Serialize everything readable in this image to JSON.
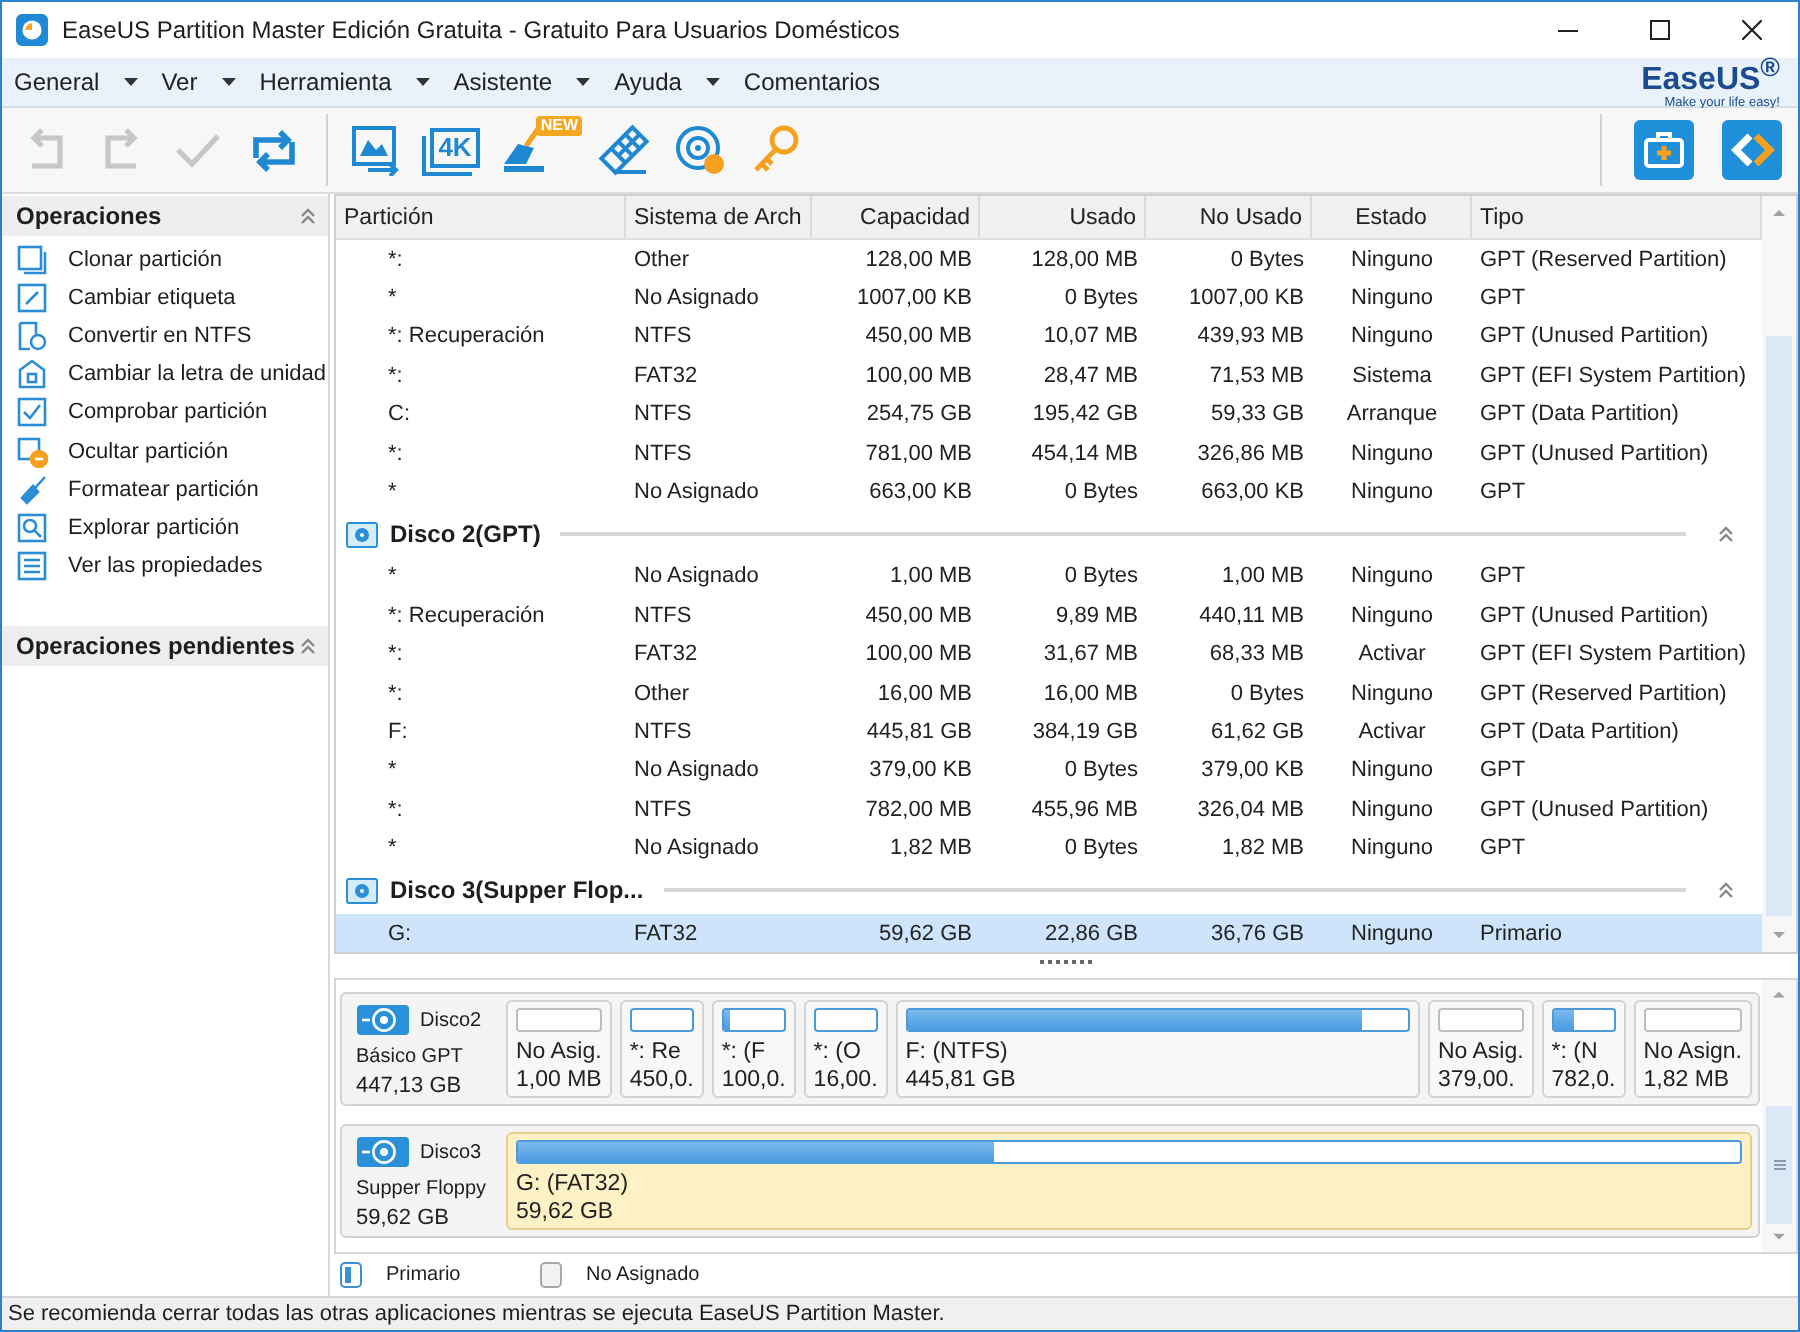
{
  "window": {
    "title": "EaseUS Partition Master Edición Gratuita - Gratuito Para Usuarios Domésticos"
  },
  "menu": [
    {
      "label": "General",
      "dropdown": true
    },
    {
      "label": "Ver",
      "dropdown": true
    },
    {
      "label": "Herramienta",
      "dropdown": true
    },
    {
      "label": "Asistente",
      "dropdown": true
    },
    {
      "label": "Ayuda",
      "dropdown": true
    },
    {
      "label": "Comentarios",
      "dropdown": false
    }
  ],
  "logo": {
    "name": "EaseUS$^{®}$",
    "tagline": "Make your life easy!"
  },
  "toolbar": {
    "buttons": [
      {
        "disabled": true
      },
      {
        "disabled": true
      },
      {
        "disabled": true
      },
      {
        "disabled": false
      },
      {
        "disabled": false
      },
      {
        "disabled": false,
        "text": "4K"
      },
      {
        "disabled": false,
        "badge": "NEW"
      },
      {
        "disabled": false
      },
      {
        "disabled": false
      },
      {
        "disabled": false
      }
    ]
  },
  "sidebar": {
    "sections": [
      {
        "title": "Operaciones",
        "expanded": true,
        "items": [
          "Clonar partición",
          "Cambiar etiqueta",
          "Convertir en NTFS",
          "Cambiar la letra de unidad",
          "Comprobar partición",
          "Ocultar partición",
          "Formatear partición",
          "Explorar partición",
          "Ver las propiedades"
        ]
      },
      {
        "title": "Operaciones pendientes",
        "expanded": true
      }
    ]
  },
  "table": {
    "columns": [
      "Partición",
      "Sistema de Arch",
      "Capacidad",
      "Usado",
      "No Usado",
      "Estado",
      "Tipo"
    ],
    "rows": [
      {
        "kind": "partition",
        "selected": false,
        "cells": [
          "*:",
          "Other",
          "128,00 MB",
          "128,00 MB",
          "0 Bytes",
          "Ninguno",
          "GPT (Reserved Partition)"
        ]
      },
      {
        "kind": "partition",
        "selected": false,
        "cells": [
          "*",
          "No Asignado",
          "1007,00 KB",
          "0 Bytes",
          "1007,00 KB",
          "Ninguno",
          "GPT"
        ]
      },
      {
        "kind": "partition",
        "selected": false,
        "cells": [
          "*: Recuperación",
          "NTFS",
          "450,00 MB",
          "10,07 MB",
          "439,93 MB",
          "Ninguno",
          "GPT (Unused Partition)"
        ]
      },
      {
        "kind": "partition",
        "selected": false,
        "cells": [
          "*:",
          "FAT32",
          "100,00 MB",
          "28,47 MB",
          "71,53 MB",
          "Sistema",
          "GPT (EFI System Partition)"
        ]
      },
      {
        "kind": "partition",
        "selected": false,
        "cells": [
          "C:",
          "NTFS",
          "254,75 GB",
          "195,42 GB",
          "59,33 GB",
          "Arranque",
          "GPT (Data Partition)"
        ]
      },
      {
        "kind": "partition",
        "selected": false,
        "cells": [
          "*:",
          "NTFS",
          "781,00 MB",
          "454,14 MB",
          "326,86 MB",
          "Ninguno",
          "GPT (Unused Partition)"
        ]
      },
      {
        "kind": "partition",
        "selected": false,
        "cells": [
          "*",
          "No Asignado",
          "663,00 KB",
          "0 Bytes",
          "663,00 KB",
          "Ninguno",
          "GPT"
        ]
      },
      {
        "kind": "disk",
        "label": "Disco 2(GPT)",
        "expanded": true
      },
      {
        "kind": "partition",
        "selected": false,
        "cells": [
          "*",
          "No Asignado",
          "1,00 MB",
          "0 Bytes",
          "1,00 MB",
          "Ninguno",
          "GPT"
        ]
      },
      {
        "kind": "partition",
        "selected": false,
        "cells": [
          "*: Recuperación",
          "NTFS",
          "450,00 MB",
          "9,89 MB",
          "440,11 MB",
          "Ninguno",
          "GPT (Unused Partition)"
        ]
      },
      {
        "kind": "partition",
        "selected": false,
        "cells": [
          "*:",
          "FAT32",
          "100,00 MB",
          "31,67 MB",
          "68,33 MB",
          "Activar",
          "GPT (EFI System Partition)"
        ]
      },
      {
        "kind": "partition",
        "selected": false,
        "cells": [
          "*:",
          "Other",
          "16,00 MB",
          "16,00 MB",
          "0 Bytes",
          "Ninguno",
          "GPT (Reserved Partition)"
        ]
      },
      {
        "kind": "partition",
        "selected": false,
        "cells": [
          "F:",
          "NTFS",
          "445,81 GB",
          "384,19 GB",
          "61,62 GB",
          "Activar",
          "GPT (Data Partition)"
        ]
      },
      {
        "kind": "partition",
        "selected": false,
        "cells": [
          "*",
          "No Asignado",
          "379,00 KB",
          "0 Bytes",
          "379,00 KB",
          "Ninguno",
          "GPT"
        ]
      },
      {
        "kind": "partition",
        "selected": false,
        "cells": [
          "*:",
          "NTFS",
          "782,00 MB",
          "455,96 MB",
          "326,04 MB",
          "Ninguno",
          "GPT (Unused Partition)"
        ]
      },
      {
        "kind": "partition",
        "selected": false,
        "cells": [
          "*",
          "No Asignado",
          "1,82 MB",
          "0 Bytes",
          "1,82 MB",
          "Ninguno",
          "GPT"
        ]
      },
      {
        "kind": "disk",
        "label": "Disco 3(Supper Flop...",
        "expanded": true
      },
      {
        "kind": "partition",
        "selected": true,
        "cells": [
          "G:",
          "FAT32",
          "59,62 GB",
          "22,86 GB",
          "36,76 GB",
          "Ninguno",
          "Primario"
        ]
      }
    ]
  },
  "disk_map": {
    "disks": [
      {
        "name": "Disco2",
        "type": "Básico GPT",
        "size": "447,13 GB",
        "partitions": [
          {
            "kind": "unallocated",
            "label": "No Asig.",
            "size": "1,00 MB",
            "selected": false
          },
          {
            "kind": "primary",
            "label": "*: Re",
            "size": "450,0.",
            "selected": false
          },
          {
            "kind": "primary",
            "label": "*: (F",
            "size": "100,0.",
            "level": 0.1,
            "selected": false
          },
          {
            "kind": "primary",
            "label": "*: (O",
            "size": "16,00.",
            "selected": false
          },
          {
            "kind": "primary",
            "label": "F: (NTFS)",
            "size": "445,81 GB",
            "level": 0.91,
            "selected": false
          },
          {
            "kind": "unallocated",
            "label": "No Asig.",
            "size": "379,00.",
            "selected": false
          },
          {
            "kind": "primary",
            "label": "*: (N",
            "size": "782,0.",
            "level": 0.35,
            "selected": false
          },
          {
            "kind": "unallocated",
            "label": "No Asign.",
            "size": "1,82 MB",
            "selected": false
          }
        ]
      },
      {
        "name": "Disco3",
        "type": "Supper Floppy",
        "size": "59,62 GB",
        "partitions": [
          {
            "kind": "primary",
            "label": "G: (FAT32)",
            "size": "59,62 GB",
            "level": 0.39,
            "selected": true
          }
        ]
      }
    ]
  },
  "legend": [
    {
      "kind": "primary",
      "label": "Primario"
    },
    {
      "kind": "unallocated",
      "label": "No Asignado"
    }
  ],
  "status_bar": {
    "text": "Se recomienda cerrar todas las otras aplicaciones mientras se ejecuta EaseUS Partition Master."
  }
}
